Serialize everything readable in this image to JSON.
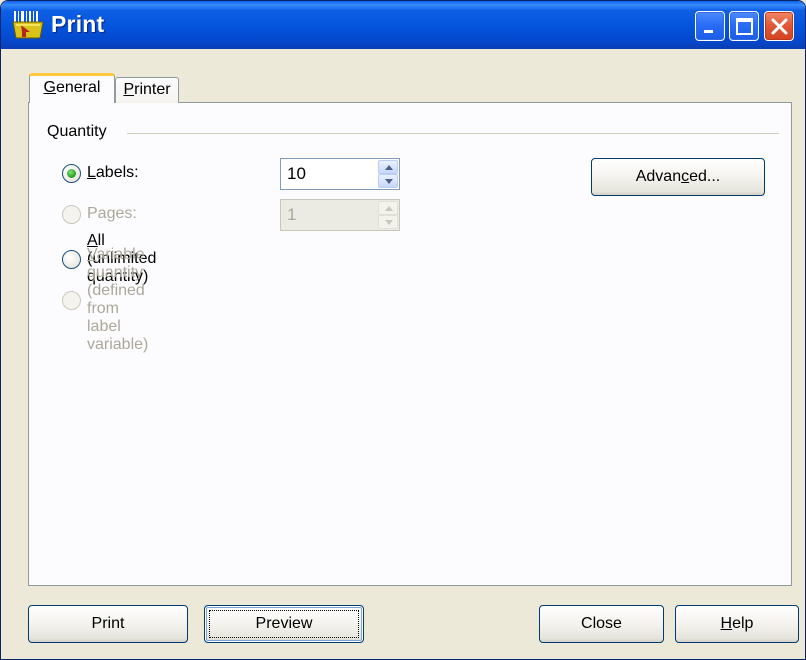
{
  "window": {
    "title": "Print",
    "icon": "barcode-printer-icon"
  },
  "tabs": [
    {
      "label": "General",
      "mnemonic": "G",
      "rest": "eneral",
      "active": true
    },
    {
      "label": "Printer",
      "mnemonic": "P",
      "rest": "rinter",
      "active": false
    }
  ],
  "quantity": {
    "group_label": "Quantity",
    "labels": {
      "mnemonic": "L",
      "rest": "abels:",
      "checked": true,
      "enabled": true,
      "value": "10"
    },
    "pages": {
      "text": "Pages:",
      "checked": false,
      "enabled": false,
      "value": "1"
    },
    "all": {
      "mnemonic": "A",
      "rest": "ll (unlimited quantity)",
      "checked": false,
      "enabled": true
    },
    "variable": {
      "mnemonic": "V",
      "rest": "ariable quantity (defined from label variable)",
      "checked": false,
      "enabled": false
    },
    "advanced_button": {
      "before": "Advan",
      "mnemonic": "c",
      "after": "ed..."
    }
  },
  "footer": {
    "print": "Print",
    "preview": "Preview",
    "close": "Close",
    "help": {
      "mnemonic": "H",
      "rest": "elp"
    }
  },
  "colors": {
    "title_bar": "#0453dc",
    "dialog_bg": "#ece9d8",
    "panel_bg": "#fcfcfe",
    "tab_highlight": "#ffc73c",
    "radio_check": "#2ea52a",
    "disabled_text": "#aca899"
  }
}
